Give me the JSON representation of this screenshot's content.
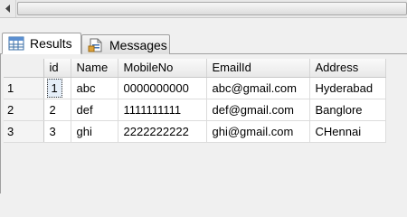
{
  "tabs": [
    {
      "label": "Results",
      "icon": "grid-icon"
    },
    {
      "label": "Messages",
      "icon": "document-icon"
    }
  ],
  "grid": {
    "columns": [
      "",
      "id",
      "Name",
      "MobileNo",
      "EmailId",
      "Address"
    ],
    "rows": [
      {
        "row_num": "1",
        "id": "1",
        "name": "abc",
        "mobile": "0000000000",
        "email": "abc@gmail.com",
        "address": "Hyderabad"
      },
      {
        "row_num": "2",
        "id": "2",
        "name": "def",
        "mobile": "1111111111",
        "email": "def@gmail.com",
        "address": "Banglore"
      },
      {
        "row_num": "3",
        "id": "3",
        "name": "ghi",
        "mobile": "2222222222",
        "email": "ghi@gmail.com",
        "address": "CHennai"
      }
    ]
  }
}
